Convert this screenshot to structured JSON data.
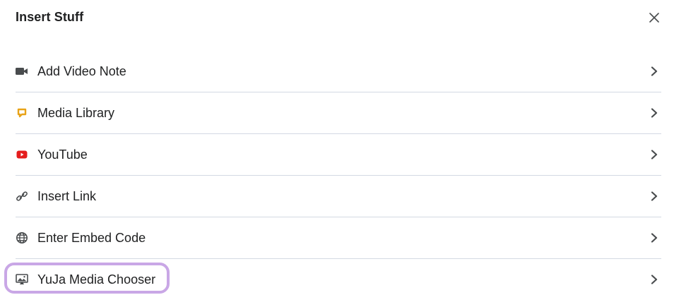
{
  "dialog": {
    "title": "Insert Stuff",
    "close_icon": "close-icon"
  },
  "items": [
    {
      "label": "Add Video Note",
      "icon": "video-camera-icon"
    },
    {
      "label": "Media Library",
      "icon": "media-library-icon"
    },
    {
      "label": "YouTube",
      "icon": "youtube-icon"
    },
    {
      "label": "Insert Link",
      "icon": "link-icon"
    },
    {
      "label": "Enter Embed Code",
      "icon": "globe-icon"
    },
    {
      "label": "YuJa Media Chooser",
      "icon": "image-monitor-icon"
    }
  ],
  "colors": {
    "media_library": "#e8a318",
    "youtube": "#e51d1d",
    "highlight": "#c9a7e6",
    "divider": "#d3d9e3",
    "icon": "#494c4e"
  }
}
